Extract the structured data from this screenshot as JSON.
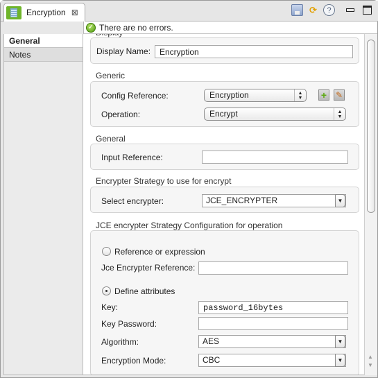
{
  "editor_tab": {
    "label": "Encryption",
    "icon": "mule-flow-icon",
    "close_icon": "close-icon"
  },
  "toolbar": {
    "icons": [
      "save-icon",
      "sync-icon",
      "help-icon",
      "minimize-icon",
      "maximize-icon"
    ],
    "help_glyph": "?",
    "sync_glyph": "⟳"
  },
  "status": {
    "icon": "check-circle-icon",
    "text": "There are no errors."
  },
  "sidebar": {
    "items": [
      {
        "label": "General",
        "active": true
      },
      {
        "label": "Notes",
        "active": false
      }
    ]
  },
  "sections": {
    "display": {
      "title": "Display",
      "display_name_label": "Display Name:",
      "display_name_value": "Encryption"
    },
    "generic": {
      "title": "Generic",
      "config_reference_label": "Config Reference:",
      "config_reference_value": "Encryption",
      "operation_label": "Operation:",
      "operation_value": "Encrypt",
      "add_icon_glyph": "+",
      "edit_icon_glyph": "✎"
    },
    "general": {
      "title": "General",
      "input_reference_label": "Input Reference:",
      "input_reference_value": ""
    },
    "strategy": {
      "title": "Encrypter Strategy to use for encrypt",
      "select_label": "Select encrypter:",
      "select_value": "JCE_ENCRYPTER"
    },
    "jce": {
      "title": "JCE encrypter Strategy Configuration for operation",
      "radio_reference_label": "Reference or expression",
      "radio_reference_checked": false,
      "jce_reference_label": "Jce Encrypter Reference:",
      "jce_reference_value": "",
      "radio_define_label": "Define attributes",
      "radio_define_checked": true,
      "key_label": "Key:",
      "key_value": "password_16bytes",
      "key_password_label": "Key Password:",
      "key_password_value": "",
      "algorithm_label": "Algorithm:",
      "algorithm_value": "AES",
      "mode_label": "Encryption Mode:",
      "mode_value": "CBC"
    }
  },
  "glyphs": {
    "updown": "▲▼",
    "down": "▼",
    "check": "✓",
    "close": "⊠"
  }
}
